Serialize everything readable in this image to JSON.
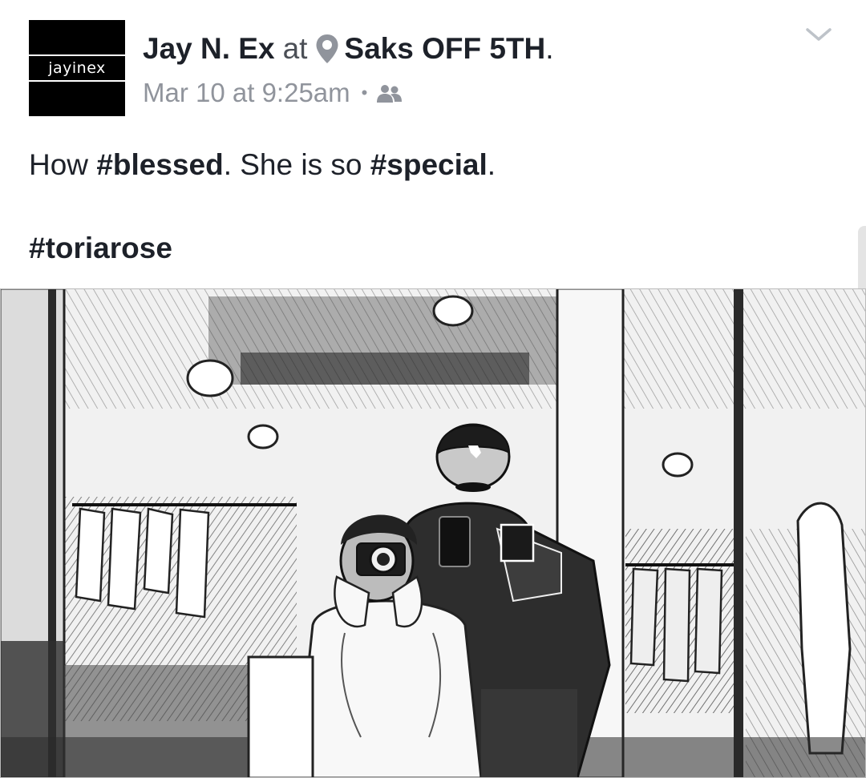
{
  "post": {
    "author": {
      "name": "Jay N. Ex",
      "avatar_text": "jayinex"
    },
    "at_word": "at",
    "place": {
      "name": "Saks OFF 5TH",
      "icon": "location-pin-icon"
    },
    "title_period": ".",
    "timestamp": "Mar 10 at 9:25am",
    "separator": "•",
    "audience_icon": "friends-icon",
    "menu_icon": "chevron-down-icon",
    "text": {
      "line1_part1": "How ",
      "hashtag1": "#blessed",
      "line1_part2": ". She is so ",
      "hashtag2": "#special",
      "line1_part3": ".",
      "hashtag3": "#toriarose"
    },
    "photo": {
      "style": "black-and-white sketch filter"
    }
  },
  "colors": {
    "text_primary": "#1d2129",
    "text_secondary": "#90949c",
    "chevron": "#bec3c9",
    "avatar_bg": "#000000"
  }
}
